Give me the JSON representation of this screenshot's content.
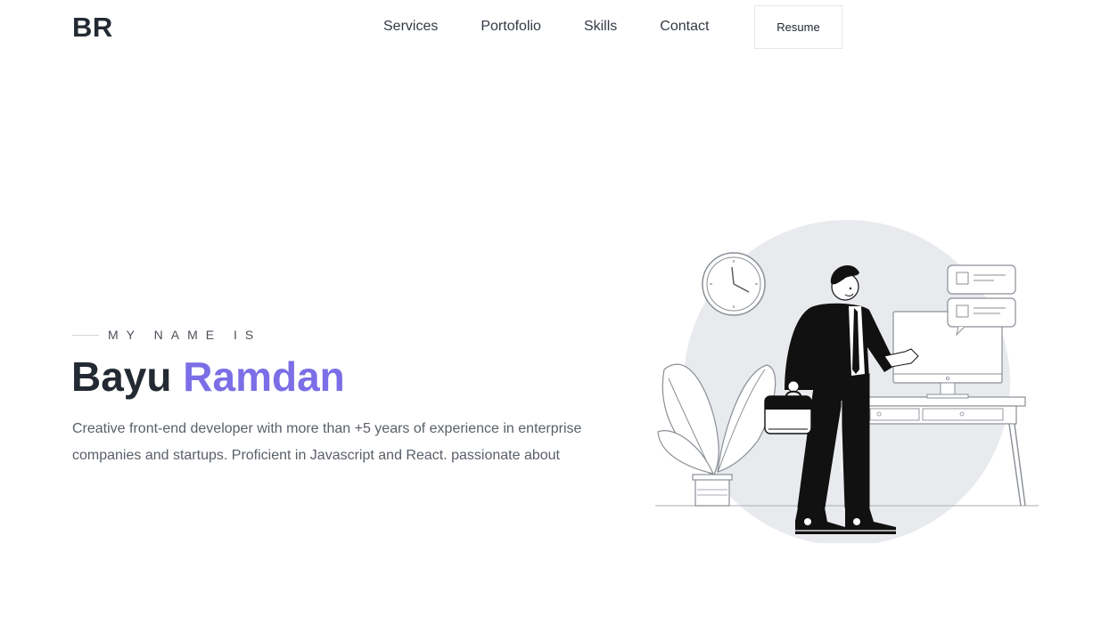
{
  "header": {
    "logo": "BR",
    "nav": [
      "Services",
      "Portofolio",
      "Skills",
      "Contact"
    ],
    "resume_label": "Resume"
  },
  "hero": {
    "eyebrow": "MY NAME IS",
    "first_name": "Bayu",
    "last_name": "Ramdan",
    "description": "Creative front-end developer with more than +5 years of experience in enterprise companies and startups. Proficient in Javascript and React. passionate about"
  },
  "colors": {
    "accent": "#7b6ee6",
    "text_dark": "#232a33",
    "text_muted": "#5a6068"
  },
  "illustration": {
    "icon": "developer-at-desk-illustration"
  }
}
